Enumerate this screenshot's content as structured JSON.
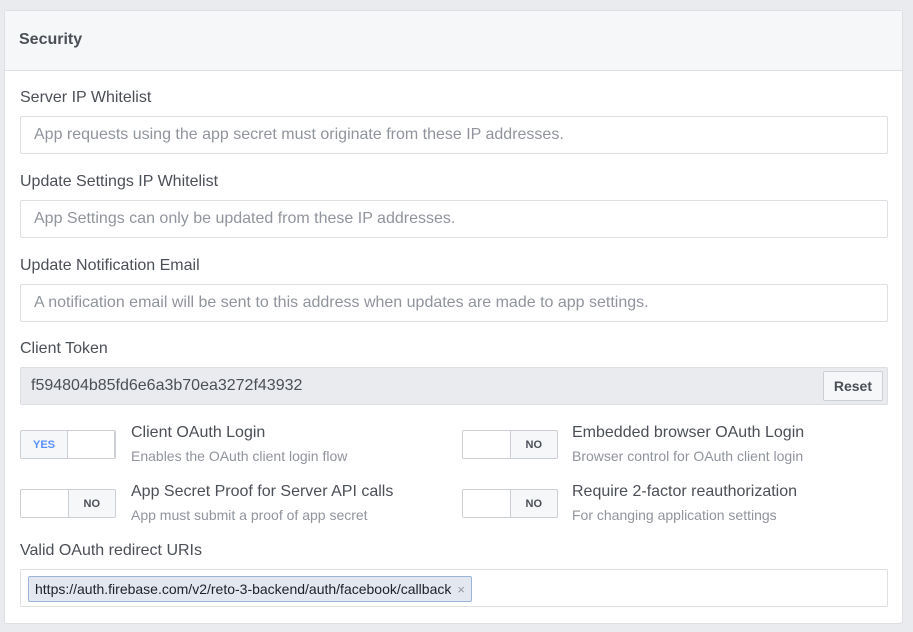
{
  "section": {
    "title": "Security"
  },
  "server_ip": {
    "label": "Server IP Whitelist",
    "placeholder": "App requests using the app secret must originate from these IP addresses."
  },
  "settings_ip": {
    "label": "Update Settings IP Whitelist",
    "placeholder": "App Settings can only be updated from these IP addresses."
  },
  "notify_email": {
    "label": "Update Notification Email",
    "placeholder": "A notification email will be sent to this address when updates are made to app settings."
  },
  "client_token": {
    "label": "Client Token",
    "value": "f594804b85fd6e6a3b70ea3272f43932",
    "reset_label": "Reset"
  },
  "toggles": [
    {
      "title": "Client OAuth Login",
      "subtitle": "Enables the OAuth client login flow",
      "state": "YES",
      "on": true
    },
    {
      "title": "Embedded browser OAuth Login",
      "subtitle": "Browser control for OAuth client login",
      "state": "NO",
      "on": false
    },
    {
      "title": "App Secret Proof for Server API calls",
      "subtitle": "App must submit a proof of app secret",
      "state": "NO",
      "on": false
    },
    {
      "title": "Require 2-factor reauthorization",
      "subtitle": "For changing application settings",
      "state": "NO",
      "on": false
    }
  ],
  "redirect_uris": {
    "label": "Valid OAuth redirect URIs",
    "tags": [
      "https://auth.firebase.com/v2/reto-3-backend/auth/facebook/callback"
    ],
    "remove_glyph": "×"
  }
}
